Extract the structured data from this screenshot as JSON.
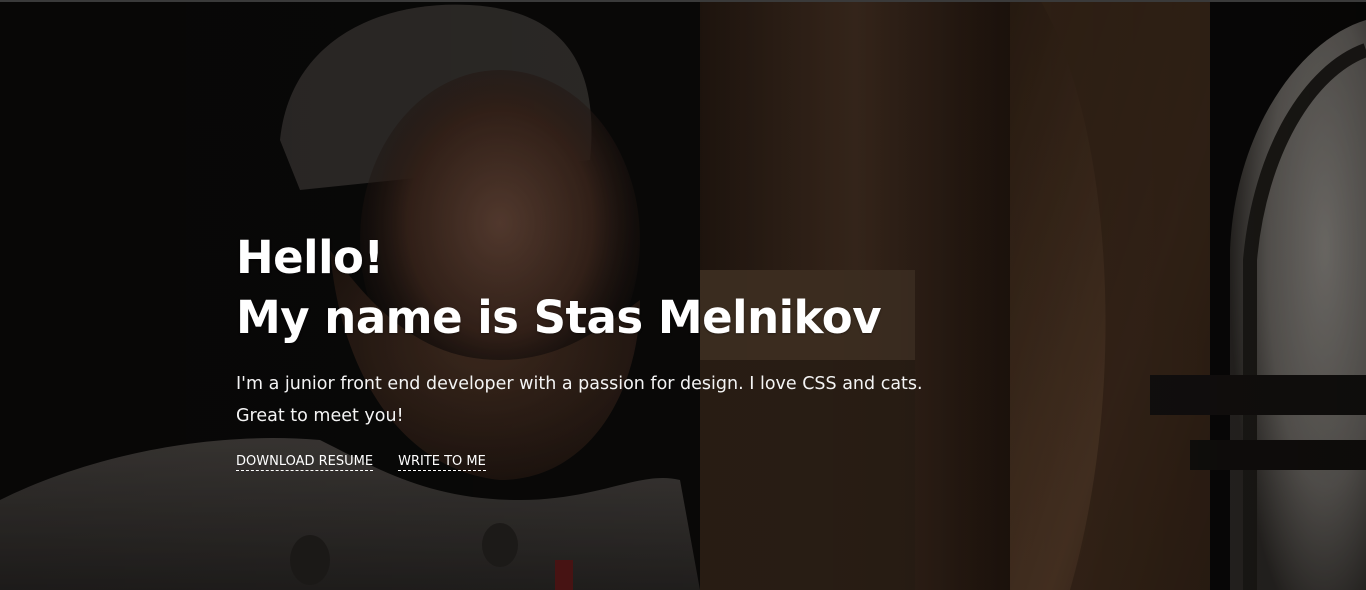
{
  "hero": {
    "background": "photo-portrait-bearded-man-window",
    "heading_line1": "Hello!",
    "heading_line2": "My name is Stas Melnikov",
    "intro": "I'm a junior front end developer with a passion for design. I love CSS and cats. Great to meet you!",
    "links": {
      "download_resume": "DOWNLOAD RESUME",
      "write_to_me": "WRITE TO ME"
    }
  },
  "colors": {
    "text": "#ffffff",
    "overlay": "#0c0b0a"
  }
}
